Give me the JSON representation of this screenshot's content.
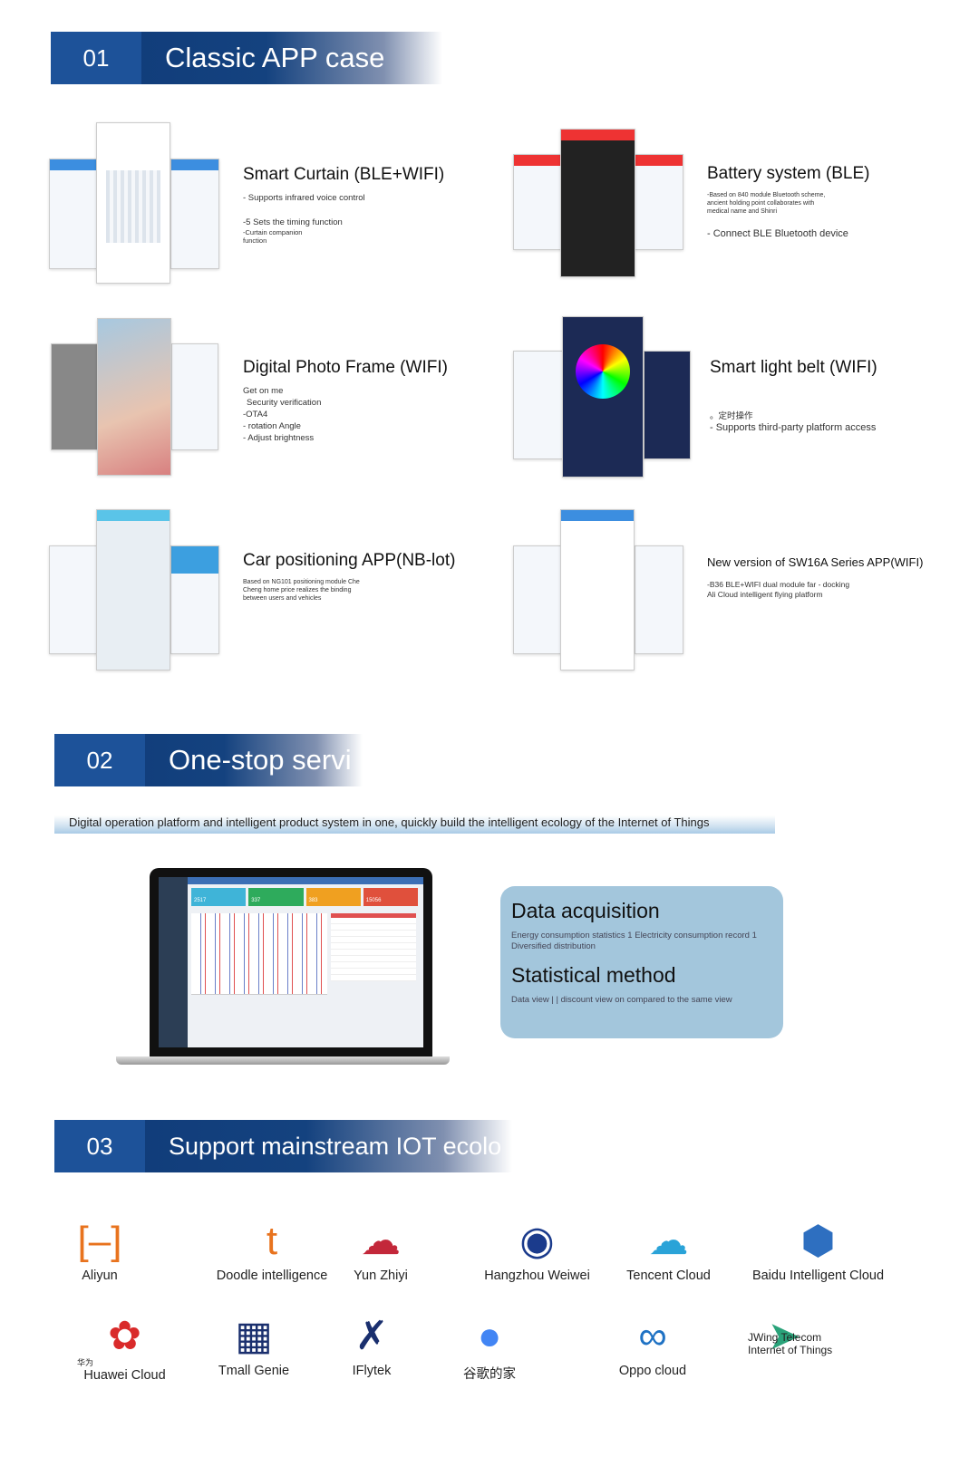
{
  "section1": {
    "number": "01",
    "title": "Classic APP case"
  },
  "cases": [
    {
      "title": "Smart Curtain (BLE+WIFI)",
      "lines": [
        "- Supports infrared voice control",
        "",
        "-5 Sets the timing function",
        "-Curtain companion function"
      ]
    },
    {
      "title": "Battery system (BLE)",
      "lines": [
        "-Based on 840 module Bluetooth scheme,",
        "ancient holding point collaborates with",
        "medical name and Shinri",
        "- Connect BLE Bluetooth device"
      ]
    },
    {
      "title": "Digital Photo Frame (WIFI)",
      "lines": [
        "Get on me",
        "Security verification",
        "-OTA4",
        "- rotation Angle",
        "- Adjust brightness"
      ]
    },
    {
      "title": "Smart light belt (WIFI)",
      "lines": [
        "。定时操作",
        "- Supports third-party platform access"
      ]
    },
    {
      "title": "Car positioning APP(NB-lot)",
      "lines": [
        "Based on NG101 positioning module Che",
        "Cheng home price realizes the binding",
        "between users and vehicles"
      ]
    },
    {
      "title": "New version of SW16A Series APP(WIFI)",
      "lines": [
        "-B36 BLE+WIFI dual module far - docking",
        "Ali Cloud intelligent flying platform"
      ]
    }
  ],
  "section2": {
    "number": "02",
    "title": "One-stop servi",
    "subtitle": "Digital operation platform and intelligent product system in one, quickly build the intelligent ecology of the Internet of Things"
  },
  "dashboard": {
    "stats": [
      "2517",
      "337",
      "383",
      "15056"
    ]
  },
  "card": {
    "h1": "Data acquisition",
    "p1": "Energy consumption statistics 1 Electricity consumption record 1 Diversified distribution",
    "h2": "Statistical method",
    "p2": "Data view | | discount view on compared to the same view"
  },
  "section3": {
    "number": "03",
    "title": "Support mainstream IOT ecolo"
  },
  "platforms": [
    {
      "name": "Aliyun",
      "icon": "aliyun-logo",
      "color": "#e8731e"
    },
    {
      "name": "Doodle intelligence",
      "icon": "tuya-logo",
      "color": "#e8731e"
    },
    {
      "name": "Yun Zhiyi",
      "icon": "cloud-house-logo",
      "color": "#c3283a"
    },
    {
      "name": "Hangzhou Weiwei",
      "icon": "weiwei-logo",
      "color": "#1b3b8c"
    },
    {
      "name": "Tencent Cloud",
      "icon": "tencent-cloud-logo",
      "color": "#2aa3d8"
    },
    {
      "name": "Baidu Intelligent Cloud",
      "icon": "baidu-cloud-logo",
      "color": "#2e6fc0"
    },
    {
      "name": "Huawei Cloud",
      "icon": "huawei-logo",
      "color": "#d92a2a",
      "sub": "华为"
    },
    {
      "name": "Tmall Genie",
      "icon": "tmall-genie-logo",
      "color": "#1a2f6e"
    },
    {
      "name": "IFlytek",
      "icon": "iflytek-logo",
      "color": "#1a2f6e"
    },
    {
      "name": "谷歌的家",
      "icon": "google-home-logo",
      "color": "#4285f4"
    },
    {
      "name": "Oppo cloud",
      "icon": "oppo-cloud-logo",
      "color": "#1f72c4"
    },
    {
      "name": "JWing Telecom Internet of Things",
      "icon": "jwing-logo",
      "color": "#2aa37a"
    }
  ]
}
